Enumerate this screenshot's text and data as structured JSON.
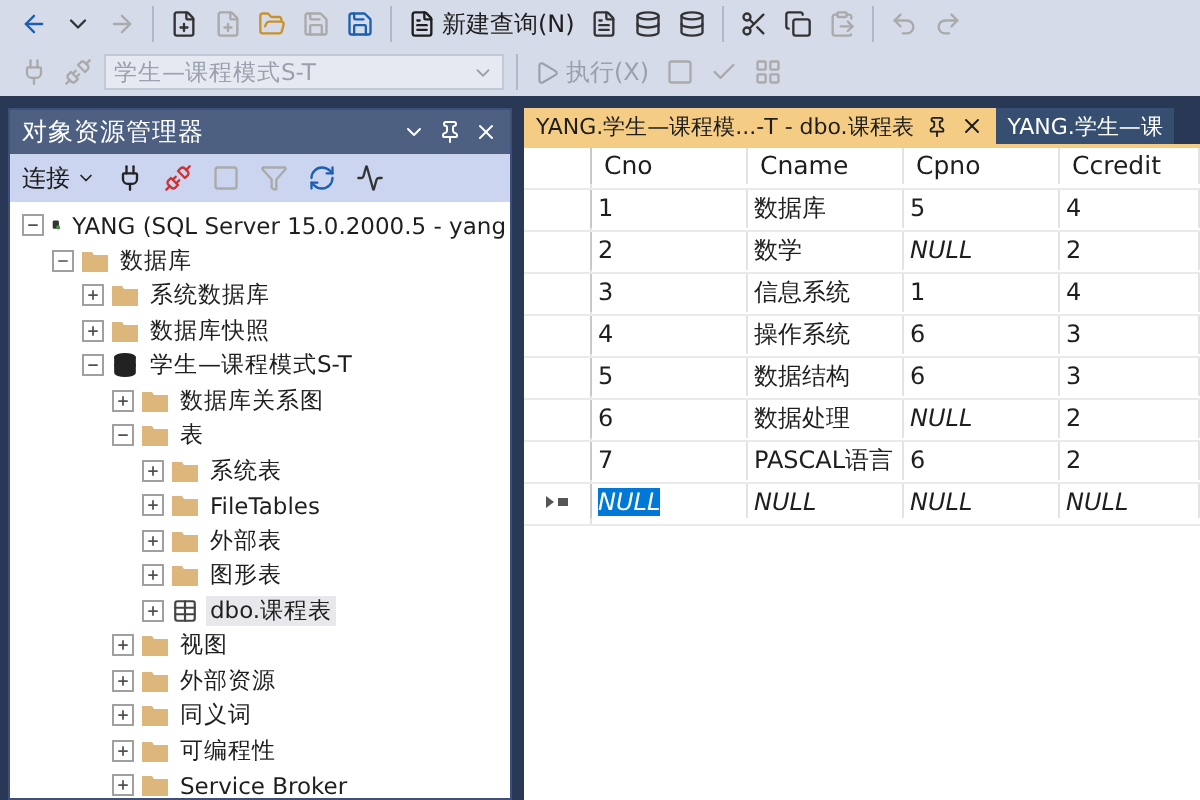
{
  "toolbar": {
    "new_query_label": "新建查询(N)",
    "database_combo": {
      "value": "学生—课程模式S-T",
      "disabled": true
    },
    "execute": {
      "label": "执行(X)",
      "disabled": true
    }
  },
  "object_explorer": {
    "title": "对象资源管理器",
    "connect_label": "连接",
    "tree": [
      {
        "label": "YANG (SQL Server 15.0.2000.5 - yang",
        "kind": "server",
        "expanded": true,
        "selected": false,
        "children": [
          {
            "label": "数据库",
            "kind": "folder",
            "expanded": true,
            "selected": false,
            "children": [
              {
                "label": "系统数据库",
                "kind": "folder",
                "expanded": false,
                "selected": false
              },
              {
                "label": "数据库快照",
                "kind": "folder",
                "expanded": false,
                "selected": false
              },
              {
                "label": "学生—课程模式S-T",
                "kind": "database",
                "expanded": true,
                "selected": false,
                "children": [
                  {
                    "label": "数据库关系图",
                    "kind": "folder",
                    "expanded": false,
                    "selected": false
                  },
                  {
                    "label": "表",
                    "kind": "folder",
                    "expanded": true,
                    "selected": false,
                    "children": [
                      {
                        "label": "系统表",
                        "kind": "folder",
                        "expanded": false,
                        "selected": false
                      },
                      {
                        "label": "FileTables",
                        "kind": "folder",
                        "expanded": false,
                        "selected": false
                      },
                      {
                        "label": "外部表",
                        "kind": "folder",
                        "expanded": false,
                        "selected": false
                      },
                      {
                        "label": "图形表",
                        "kind": "folder",
                        "expanded": false,
                        "selected": false
                      },
                      {
                        "label": "dbo.课程表",
                        "kind": "table",
                        "expanded": false,
                        "selected": true
                      }
                    ]
                  },
                  {
                    "label": "视图",
                    "kind": "folder",
                    "expanded": false,
                    "selected": false
                  },
                  {
                    "label": "外部资源",
                    "kind": "folder",
                    "expanded": false,
                    "selected": false
                  },
                  {
                    "label": "同义词",
                    "kind": "folder",
                    "expanded": false,
                    "selected": false
                  },
                  {
                    "label": "可编程性",
                    "kind": "folder",
                    "expanded": false,
                    "selected": false
                  },
                  {
                    "label": "Service Broker",
                    "kind": "folder",
                    "expanded": false,
                    "selected": false
                  }
                ]
              }
            ]
          }
        ]
      }
    ]
  },
  "tabs": [
    {
      "label": "YANG.学生—课程模...-T - dbo.课程表",
      "selected": true
    },
    {
      "label": "YANG.学生—课",
      "selected": false
    }
  ],
  "grid": {
    "columns": [
      "Cno",
      "Cname",
      "Cpno",
      "Ccredit"
    ],
    "rows": [
      {
        "new": false,
        "cells": [
          {
            "text": "1",
            "is_null": false,
            "selected": false
          },
          {
            "text": "数据库",
            "is_null": false,
            "selected": false
          },
          {
            "text": "5",
            "is_null": false,
            "selected": false
          },
          {
            "text": "4",
            "is_null": false,
            "selected": false
          }
        ]
      },
      {
        "new": false,
        "cells": [
          {
            "text": "2",
            "is_null": false,
            "selected": false
          },
          {
            "text": "数学",
            "is_null": false,
            "selected": false
          },
          {
            "text": "NULL",
            "is_null": true,
            "selected": false
          },
          {
            "text": "2",
            "is_null": false,
            "selected": false
          }
        ]
      },
      {
        "new": false,
        "cells": [
          {
            "text": "3",
            "is_null": false,
            "selected": false
          },
          {
            "text": "信息系统",
            "is_null": false,
            "selected": false
          },
          {
            "text": "1",
            "is_null": false,
            "selected": false
          },
          {
            "text": "4",
            "is_null": false,
            "selected": false
          }
        ]
      },
      {
        "new": false,
        "cells": [
          {
            "text": "4",
            "is_null": false,
            "selected": false
          },
          {
            "text": "操作系统",
            "is_null": false,
            "selected": false
          },
          {
            "text": "6",
            "is_null": false,
            "selected": false
          },
          {
            "text": "3",
            "is_null": false,
            "selected": false
          }
        ]
      },
      {
        "new": false,
        "cells": [
          {
            "text": "5",
            "is_null": false,
            "selected": false
          },
          {
            "text": "数据结构",
            "is_null": false,
            "selected": false
          },
          {
            "text": "6",
            "is_null": false,
            "selected": false
          },
          {
            "text": "3",
            "is_null": false,
            "selected": false
          }
        ]
      },
      {
        "new": false,
        "cells": [
          {
            "text": "6",
            "is_null": false,
            "selected": false
          },
          {
            "text": "数据处理",
            "is_null": false,
            "selected": false
          },
          {
            "text": "NULL",
            "is_null": true,
            "selected": false
          },
          {
            "text": "2",
            "is_null": false,
            "selected": false
          }
        ]
      },
      {
        "new": false,
        "cells": [
          {
            "text": "7",
            "is_null": false,
            "selected": false
          },
          {
            "text": "PASCAL语言",
            "is_null": false,
            "selected": false
          },
          {
            "text": "6",
            "is_null": false,
            "selected": false
          },
          {
            "text": "2",
            "is_null": false,
            "selected": false
          }
        ]
      },
      {
        "new": true,
        "cells": [
          {
            "text": "NULL",
            "is_null": true,
            "selected": true
          },
          {
            "text": "NULL",
            "is_null": true,
            "selected": false
          },
          {
            "text": "NULL",
            "is_null": true,
            "selected": false
          },
          {
            "text": "NULL",
            "is_null": true,
            "selected": false
          }
        ]
      }
    ]
  }
}
